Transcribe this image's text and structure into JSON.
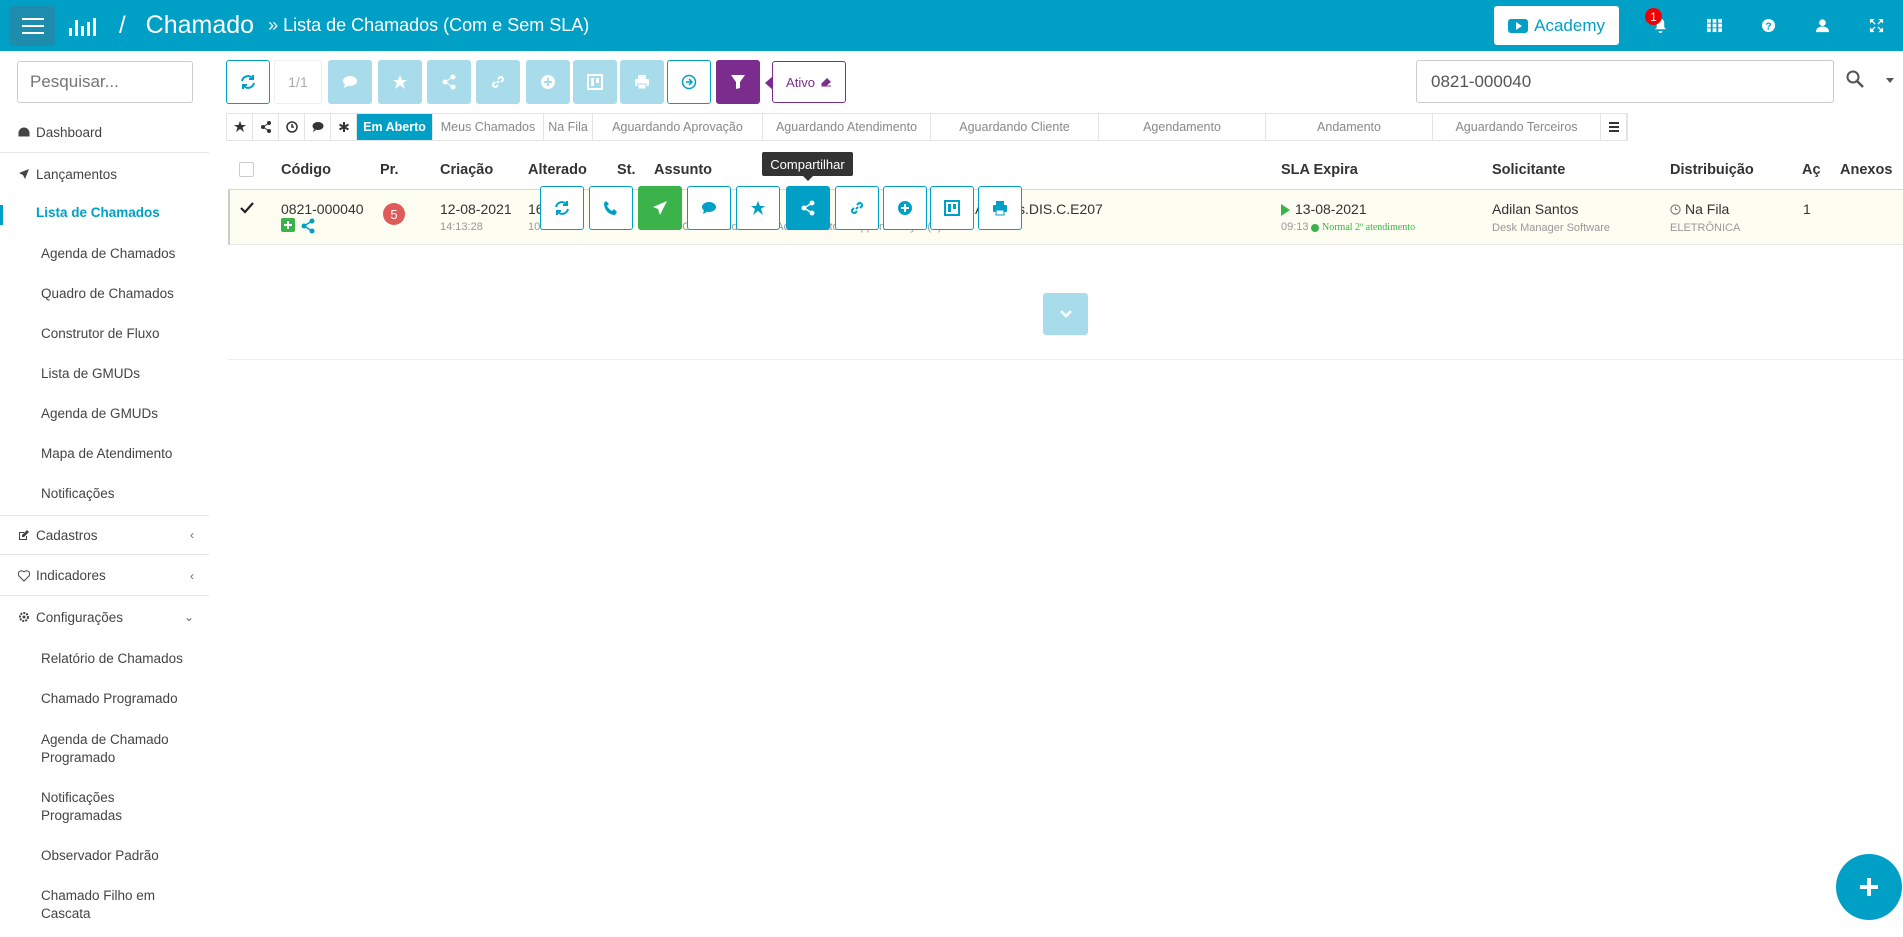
{
  "header": {
    "app_title": "Chamado",
    "slash": "/",
    "breadcrumb": "» Lista de Chamados (Com e Sem SLA)",
    "academy_label": "Academy",
    "notification_count": "1"
  },
  "sidebar": {
    "search_placeholder": "Pesquisar...",
    "items": [
      {
        "label": "Dashboard"
      },
      {
        "label": "Lançamentos"
      },
      {
        "label": "Lista de Chamados"
      },
      {
        "label": "Agenda de Chamados"
      },
      {
        "label": "Quadro de Chamados"
      },
      {
        "label": "Construtor de Fluxo"
      },
      {
        "label": "Lista de GMUDs"
      },
      {
        "label": "Agenda de GMUDs"
      },
      {
        "label": "Mapa de Atendimento"
      },
      {
        "label": "Notificações"
      },
      {
        "label": "Cadastros"
      },
      {
        "label": "Indicadores"
      },
      {
        "label": "Configurações"
      },
      {
        "label": "Relatório de Chamados"
      },
      {
        "label": "Chamado Programado"
      },
      {
        "label": "Agenda de Chamado"
      },
      {
        "label": "Programado"
      },
      {
        "label": "Notificações"
      },
      {
        "label": "Programadas"
      },
      {
        "label": "Observador Padrão"
      },
      {
        "label": "Chamado Filho em"
      },
      {
        "label": "Cascata"
      }
    ]
  },
  "toolbar": {
    "page_count": "1/1",
    "active_filter_label": "Ativo",
    "search_value": "0821-000040"
  },
  "filter_tabs": [
    "Em Aberto",
    "Meus Chamados",
    "Na Fila",
    "Aguardando Aprovação",
    "Aguardando Atendimento",
    "Aguardando Cliente",
    "Agendamento",
    "Andamento",
    "Aguardando Terceiros"
  ],
  "table": {
    "columns": [
      "Código",
      "Pr.",
      "Criação",
      "Alterado",
      "St.",
      "Assunto",
      "SLA Expira",
      "Solicitante",
      "Distribuição",
      "Aç",
      "Anexos"
    ],
    "row": {
      "codigo": "0821-000040",
      "prioridade": "5",
      "criacao_data": "12-08-2021",
      "criacao_hora": "14:13:28",
      "alterado_data": "16",
      "alterado_hora_partial": "10:45:54",
      "alterado_extra": "2",
      "assunto_partial": "s.DIS.C.E207",
      "assunto_sub_partial": "WEB/GCR Atendimento: Adilan Santos Support Analyst (T)...",
      "assunto_fragment": "A",
      "sla_data": "13-08-2021",
      "sla_hora": "09:13",
      "sla_status": "Normal 2º atendimento",
      "solicitante": "Adilan Santos",
      "solicitante_empresa": "Desk Manager Software",
      "distribuicao": "Na Fila",
      "distribuicao_sub": "ELETRÔNICA",
      "acoes": "1"
    }
  },
  "tooltip": "Compartilhar",
  "colors": {
    "primary": "#00a0c6",
    "filter": "#7b2d8e",
    "green": "#3cb24a",
    "priority": "#e05a5a",
    "disabled": "#a9dcea"
  }
}
